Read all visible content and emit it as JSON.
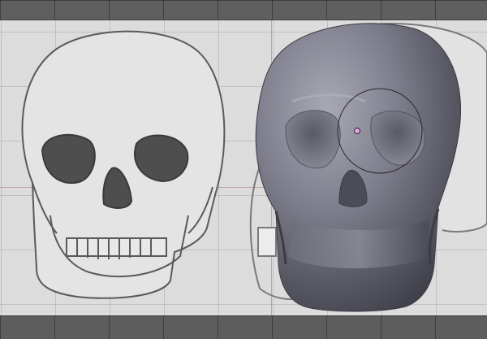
{
  "viewport": {
    "background_color": "#dcdcdc",
    "grid_color": "#a0a0a0"
  },
  "reference_image": {
    "subject": "skull-sketch-front",
    "stroke_color": "#5a5a5a"
  },
  "model": {
    "subject": "sculpted-skull-mesh",
    "shade_color": "#6a6a78"
  },
  "brush": {
    "circle_color": "#2a2a2a",
    "center_dot_color": "#e8a0e8"
  }
}
